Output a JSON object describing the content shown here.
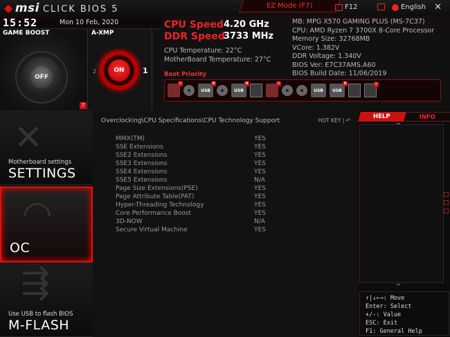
{
  "topbar": {
    "logo_msi": "msi",
    "logo_click": "CLICK BIOS 5",
    "ez_mode": "EZ Mode (F7)",
    "screenshot": "F12",
    "language": "English",
    "close": "✕"
  },
  "clock": {
    "time": "15:52",
    "date": "Mon 10 Feb, 2020"
  },
  "game_boost": {
    "title": "GAME BOOST",
    "state": "OFF",
    "help": "?"
  },
  "axmp": {
    "title": "A-XMP",
    "state": "ON",
    "left": "2",
    "right": "1"
  },
  "speed": {
    "cpu_label": "CPU Speed",
    "cpu_value": "4.20 GHz",
    "ddr_label": "DDR Speed",
    "ddr_value": "3733 MHz",
    "cpu_temp": "CPU Temperature: 22°C",
    "mb_temp": "MotherBoard Temperature: 27°C"
  },
  "sysinfo": [
    "MB: MPG X570 GAMING PLUS (MS-7C37)",
    "CPU: AMD Ryzen 7 3700X 8-Core Processor",
    "Memory Size: 32768MB",
    "VCore: 1.382V",
    "DDR Voltage: 1.340V",
    "BIOS Ver: E7C37AMS.A60",
    "BIOS Build Date: 11/06/2019"
  ],
  "boot": {
    "title": "Boot Priority",
    "devices": [
      "hdd",
      "disc",
      "usb",
      "disc",
      "usb",
      "net",
      "hdd",
      "disc",
      "disc",
      "usb",
      "usb",
      "net",
      "net"
    ],
    "usb_label": "USB",
    "u_mark": "U"
  },
  "nav": {
    "settings_sub": "Motherboard settings",
    "settings_big": "SETTINGS",
    "oc_big": "OC",
    "mflash_sub": "Use USB to flash BIOS",
    "mflash_big": "M-FLASH"
  },
  "main": {
    "breadcrumb": "Overclocking\\CPU Specifications\\CPU Technology Support",
    "hotkey": "HOT KEY",
    "rows": [
      {
        "name": "MMX(TM)",
        "value": "YES"
      },
      {
        "name": "SSE Extensions",
        "value": "YES"
      },
      {
        "name": "SSE2 Extensions",
        "value": "YES"
      },
      {
        "name": "SSE3 Extensions",
        "value": "YES"
      },
      {
        "name": "SSE4 Extensions",
        "value": "YES"
      },
      {
        "name": "SSE5 Extensions",
        "value": "N/A"
      },
      {
        "name": "Page Size Extensions(PSE)",
        "value": "YES"
      },
      {
        "name": "Page Attribute Table(PAT)",
        "value": "YES"
      },
      {
        "name": "Hyper-Threading Technology",
        "value": "YES"
      },
      {
        "name": "Core Performance Boost",
        "value": "YES"
      },
      {
        "name": "3D-NOW",
        "value": "N/A"
      },
      {
        "name": "Secure Virtual Machine",
        "value": "YES"
      }
    ]
  },
  "help": {
    "tab_help": "HELP",
    "tab_info": "INFO",
    "keys": [
      "↑|↓←→: Move",
      "Enter: Select",
      "+/-: Value",
      "ESC: Exit",
      "F1: General Help"
    ]
  },
  "colors": {
    "accent": "#dd1111",
    "bg": "#111111",
    "text": "#cccccc"
  }
}
